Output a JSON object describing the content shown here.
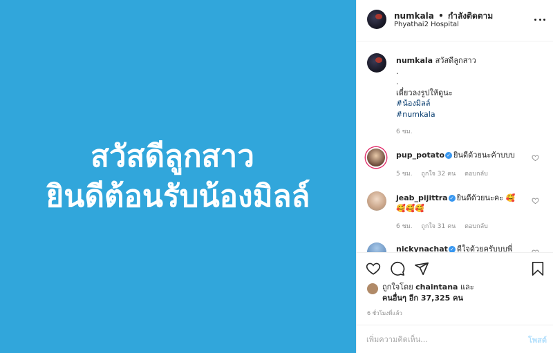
{
  "image": {
    "line1": "สวัสดีลูกสาว",
    "line2": "ยินดีต้อนรับน้องมิลล์",
    "background_color": "#31a6db"
  },
  "header": {
    "username": "numkala",
    "separator": "•",
    "follow_status": "กำลังติดตาม",
    "location": "Phyathai2 Hospital",
    "more_icon": "more-options-icon"
  },
  "caption": {
    "username": "numkala",
    "text": "สวัสดีลูกสาว",
    "lines": [
      ".",
      ".",
      "เดี๋ยวลงรูปให้ดูนะ"
    ],
    "tags": [
      "#น้องมิลล์",
      "#numkala"
    ],
    "time": "6 ชม."
  },
  "comments": [
    {
      "username": "pup_potato",
      "verified": true,
      "text": "ยินดีด้วยนะค้าบบบ",
      "time": "5 ชม.",
      "likes": "ถูกใจ 32 คน",
      "reply": "ตอบกลับ"
    },
    {
      "username": "jeab_pijittra",
      "verified": true,
      "text": "ยินดีด้วยนะคะ 🥰",
      "text2": "🥰🥰🥰",
      "time": "6 ชม.",
      "likes": "ถูกใจ 31 คน",
      "reply": "ตอบกลับ"
    },
    {
      "username": "nickynachat",
      "verified": true,
      "text": "ดีใจด้วยครับบบพี่"
    }
  ],
  "likes": {
    "prefix": "ถูกใจโดย",
    "liker": "chaintana",
    "and": "และ",
    "others": "คนอื่นๆ อีก 37,325 คน"
  },
  "post_time": "6 ชั่วโมงที่แล้ว",
  "add_comment": {
    "placeholder": "เพิ่มความคิดเห็น...",
    "post_label": "โพสต์"
  },
  "icons": {
    "like": "heart-icon",
    "comment": "comment-icon",
    "share": "share-icon",
    "save": "bookmark-icon"
  }
}
